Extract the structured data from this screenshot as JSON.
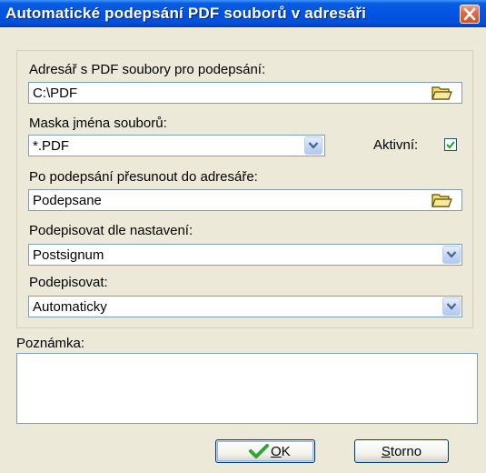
{
  "window": {
    "title": "Automatické podepsání PDF souborů v adresáři"
  },
  "form": {
    "folder_label": "Adresář s PDF soubory pro podepsání:",
    "folder_value": "C:\\PDF",
    "mask_label": "Maska jména souborů:",
    "mask_value": "*.PDF",
    "active_label": "Aktivní:",
    "active_checked": true,
    "move_label": "Po podepsání přesunout do adresáře:",
    "move_value": "Podepsane",
    "settings_label": "Podepisovat dle nastavení:",
    "settings_value": "Postsignum",
    "sign_mode_label": "Podepisovat:",
    "sign_mode_value": "Automaticky",
    "note_label": "Poznámka:",
    "note_value": ""
  },
  "buttons": {
    "ok_label": "OK",
    "ok_accel": "O",
    "ok_rest": "K",
    "cancel_label": "Storno",
    "cancel_accel": "S",
    "cancel_rest": "torno"
  },
  "icons": {
    "close": "close-icon",
    "folder": "folder-icon",
    "dropdown": "chevron-down-icon",
    "check": "checkmark-icon"
  }
}
